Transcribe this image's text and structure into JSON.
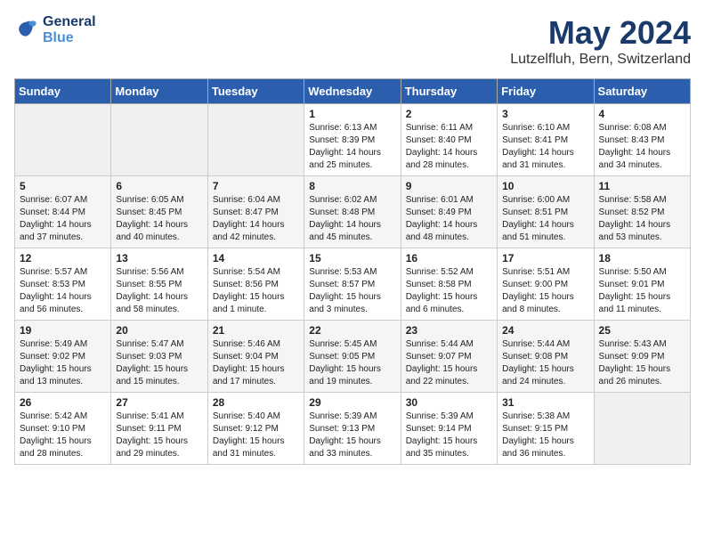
{
  "logo": {
    "line1": "General",
    "line2": "Blue"
  },
  "title": "May 2024",
  "subtitle": "Lutzelfluh, Bern, Switzerland",
  "weekdays": [
    "Sunday",
    "Monday",
    "Tuesday",
    "Wednesday",
    "Thursday",
    "Friday",
    "Saturday"
  ],
  "weeks": [
    [
      {
        "day": "",
        "info": ""
      },
      {
        "day": "",
        "info": ""
      },
      {
        "day": "",
        "info": ""
      },
      {
        "day": "1",
        "info": "Sunrise: 6:13 AM\nSunset: 8:39 PM\nDaylight: 14 hours\nand 25 minutes."
      },
      {
        "day": "2",
        "info": "Sunrise: 6:11 AM\nSunset: 8:40 PM\nDaylight: 14 hours\nand 28 minutes."
      },
      {
        "day": "3",
        "info": "Sunrise: 6:10 AM\nSunset: 8:41 PM\nDaylight: 14 hours\nand 31 minutes."
      },
      {
        "day": "4",
        "info": "Sunrise: 6:08 AM\nSunset: 8:43 PM\nDaylight: 14 hours\nand 34 minutes."
      }
    ],
    [
      {
        "day": "5",
        "info": "Sunrise: 6:07 AM\nSunset: 8:44 PM\nDaylight: 14 hours\nand 37 minutes."
      },
      {
        "day": "6",
        "info": "Sunrise: 6:05 AM\nSunset: 8:45 PM\nDaylight: 14 hours\nand 40 minutes."
      },
      {
        "day": "7",
        "info": "Sunrise: 6:04 AM\nSunset: 8:47 PM\nDaylight: 14 hours\nand 42 minutes."
      },
      {
        "day": "8",
        "info": "Sunrise: 6:02 AM\nSunset: 8:48 PM\nDaylight: 14 hours\nand 45 minutes."
      },
      {
        "day": "9",
        "info": "Sunrise: 6:01 AM\nSunset: 8:49 PM\nDaylight: 14 hours\nand 48 minutes."
      },
      {
        "day": "10",
        "info": "Sunrise: 6:00 AM\nSunset: 8:51 PM\nDaylight: 14 hours\nand 51 minutes."
      },
      {
        "day": "11",
        "info": "Sunrise: 5:58 AM\nSunset: 8:52 PM\nDaylight: 14 hours\nand 53 minutes."
      }
    ],
    [
      {
        "day": "12",
        "info": "Sunrise: 5:57 AM\nSunset: 8:53 PM\nDaylight: 14 hours\nand 56 minutes."
      },
      {
        "day": "13",
        "info": "Sunrise: 5:56 AM\nSunset: 8:55 PM\nDaylight: 14 hours\nand 58 minutes."
      },
      {
        "day": "14",
        "info": "Sunrise: 5:54 AM\nSunset: 8:56 PM\nDaylight: 15 hours\nand 1 minute."
      },
      {
        "day": "15",
        "info": "Sunrise: 5:53 AM\nSunset: 8:57 PM\nDaylight: 15 hours\nand 3 minutes."
      },
      {
        "day": "16",
        "info": "Sunrise: 5:52 AM\nSunset: 8:58 PM\nDaylight: 15 hours\nand 6 minutes."
      },
      {
        "day": "17",
        "info": "Sunrise: 5:51 AM\nSunset: 9:00 PM\nDaylight: 15 hours\nand 8 minutes."
      },
      {
        "day": "18",
        "info": "Sunrise: 5:50 AM\nSunset: 9:01 PM\nDaylight: 15 hours\nand 11 minutes."
      }
    ],
    [
      {
        "day": "19",
        "info": "Sunrise: 5:49 AM\nSunset: 9:02 PM\nDaylight: 15 hours\nand 13 minutes."
      },
      {
        "day": "20",
        "info": "Sunrise: 5:47 AM\nSunset: 9:03 PM\nDaylight: 15 hours\nand 15 minutes."
      },
      {
        "day": "21",
        "info": "Sunrise: 5:46 AM\nSunset: 9:04 PM\nDaylight: 15 hours\nand 17 minutes."
      },
      {
        "day": "22",
        "info": "Sunrise: 5:45 AM\nSunset: 9:05 PM\nDaylight: 15 hours\nand 19 minutes."
      },
      {
        "day": "23",
        "info": "Sunrise: 5:44 AM\nSunset: 9:07 PM\nDaylight: 15 hours\nand 22 minutes."
      },
      {
        "day": "24",
        "info": "Sunrise: 5:44 AM\nSunset: 9:08 PM\nDaylight: 15 hours\nand 24 minutes."
      },
      {
        "day": "25",
        "info": "Sunrise: 5:43 AM\nSunset: 9:09 PM\nDaylight: 15 hours\nand 26 minutes."
      }
    ],
    [
      {
        "day": "26",
        "info": "Sunrise: 5:42 AM\nSunset: 9:10 PM\nDaylight: 15 hours\nand 28 minutes."
      },
      {
        "day": "27",
        "info": "Sunrise: 5:41 AM\nSunset: 9:11 PM\nDaylight: 15 hours\nand 29 minutes."
      },
      {
        "day": "28",
        "info": "Sunrise: 5:40 AM\nSunset: 9:12 PM\nDaylight: 15 hours\nand 31 minutes."
      },
      {
        "day": "29",
        "info": "Sunrise: 5:39 AM\nSunset: 9:13 PM\nDaylight: 15 hours\nand 33 minutes."
      },
      {
        "day": "30",
        "info": "Sunrise: 5:39 AM\nSunset: 9:14 PM\nDaylight: 15 hours\nand 35 minutes."
      },
      {
        "day": "31",
        "info": "Sunrise: 5:38 AM\nSunset: 9:15 PM\nDaylight: 15 hours\nand 36 minutes."
      },
      {
        "day": "",
        "info": ""
      }
    ]
  ]
}
